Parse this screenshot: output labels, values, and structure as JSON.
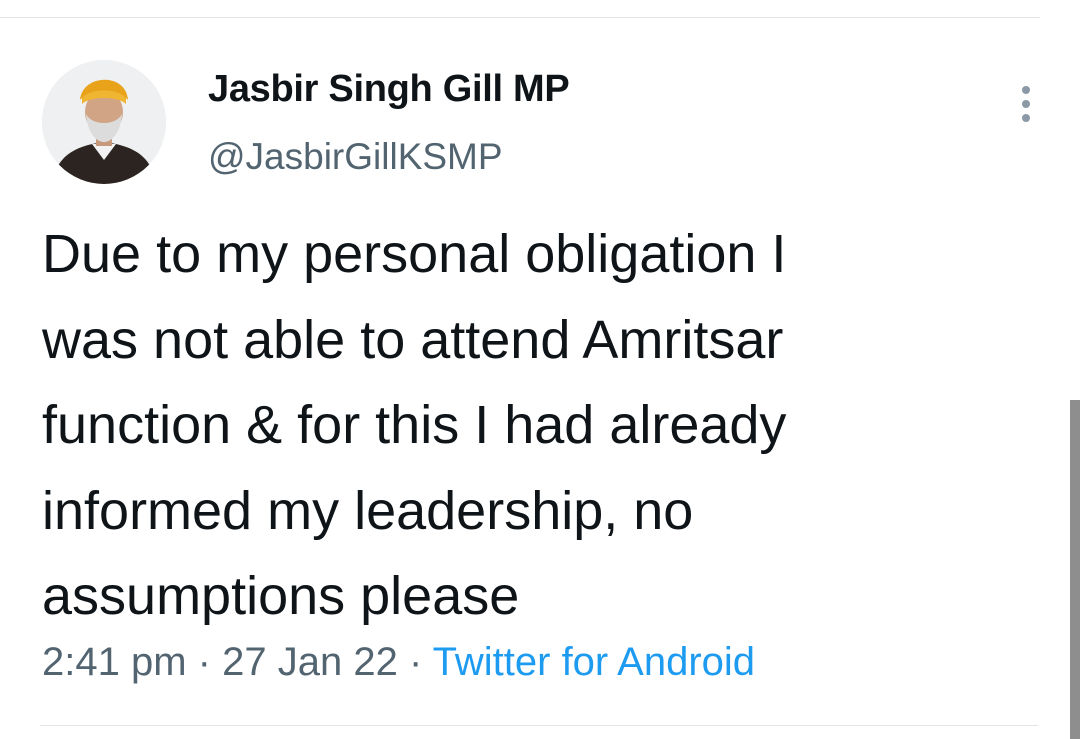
{
  "author": {
    "display_name": "Jasbir Singh Gill MP",
    "handle": "@JasbirGillKSMP"
  },
  "tweet": {
    "lines": [
      "Due to my personal obligation I",
      "was not able to attend Amritsar",
      "function & for this I had already",
      "informed my leadership, no",
      "assumptions please"
    ]
  },
  "meta": {
    "time": "2:41 pm",
    "separator": "·",
    "date": "27 Jan 22",
    "source": "Twitter for Android"
  },
  "icons": {
    "more": "more-options-icon",
    "avatar": "profile-avatar"
  },
  "colors": {
    "text_primary": "#0f1419",
    "text_secondary": "#536471",
    "link": "#1d9bf0",
    "divider": "#e3e6e8"
  }
}
